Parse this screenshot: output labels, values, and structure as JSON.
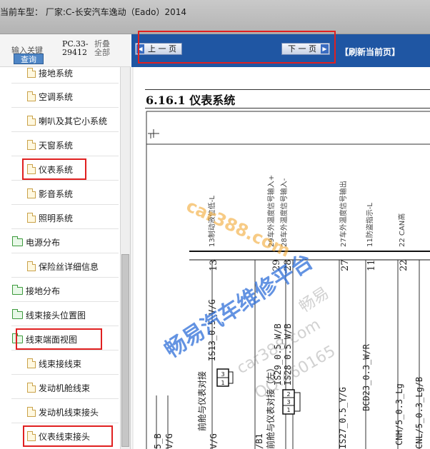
{
  "window": {
    "title": "当前车型：  厂家:C-长安汽车逸动（Eado）2014"
  },
  "search": {
    "label": "输入关键",
    "button": "查询",
    "pc_code_line1": "PC.33-",
    "pc_code_line2": "29412",
    "collapse_line1": "折叠",
    "collapse_line2": "全部"
  },
  "tree": {
    "items": [
      {
        "label": "接地系统",
        "type": "file"
      },
      {
        "label": "空调系统",
        "type": "file"
      },
      {
        "label": "喇叭及其它小系统",
        "type": "file"
      },
      {
        "label": "天窗系统",
        "type": "file"
      },
      {
        "label": "仪表系统",
        "type": "file"
      },
      {
        "label": "影音系统",
        "type": "file"
      },
      {
        "label": "照明系统",
        "type": "file"
      },
      {
        "label": "电源分布",
        "type": "folder"
      },
      {
        "label": "保险丝详细信息",
        "type": "file"
      },
      {
        "label": "接地分布",
        "type": "folder"
      },
      {
        "label": "线束接头位置图",
        "type": "folder"
      },
      {
        "label": "线束端面视图",
        "type": "folder"
      },
      {
        "label": "线束接线束",
        "type": "file"
      },
      {
        "label": "发动机舱线束",
        "type": "file"
      },
      {
        "label": "发动机线束接头",
        "type": "file"
      },
      {
        "label": "仪表线束接头",
        "type": "file"
      }
    ]
  },
  "nav": {
    "prev": "上 一 页",
    "next": "下 一 页",
    "refresh": "【刷新当前页】"
  },
  "document": {
    "section_title": "6.16.1  仪表系统",
    "pins": [
      {
        "num": "13",
        "label": "13制动液位低-L",
        "wire": "IS13_0.5_V/G"
      },
      {
        "num": "29",
        "label": "29车外温度信号输入+",
        "wire": "IS29_0.5_W/B"
      },
      {
        "num": "28",
        "label": "28车外温度信号输入-",
        "wire": "IS28_0.5_W/B"
      },
      {
        "num": "27",
        "label": "27车外温度信号输出",
        "wire": "IS27_0.5_Y/G"
      },
      {
        "num": "11",
        "label": "11防盗指示-L",
        "wire": "BCD23_0.3_W/R"
      },
      {
        "num": "22",
        "label": "22 CAN高",
        "wire": "CNH/5_0.3_Lg"
      },
      {
        "num": "",
        "label": "",
        "wire": "CNL/5_0.3_Lg/B"
      }
    ],
    "connector_label_1": "前舱与仪表对接",
    "connector_label_2": "前舱与仪表对接（左）",
    "connector_pins_1": [
      "3",
      "1"
    ],
    "connector_pins_2": [
      "2",
      "3",
      "1"
    ],
    "left_wire_1": "5_B",
    "left_wire_2": "V/G",
    "left_wire_3": "/B1",
    "left_wire_4": "V/G",
    "watermark_1": "car388.com",
    "watermark_2": "畅易汽车维修平台",
    "watermark_3": "畅易",
    "watermark_4": "car388.com",
    "watermark_5": "QQ:460165"
  },
  "colors": {
    "accent_blue": "#1f56a3",
    "highlight_red": "#e02020",
    "watermark_blue": "#2f6fd8"
  }
}
